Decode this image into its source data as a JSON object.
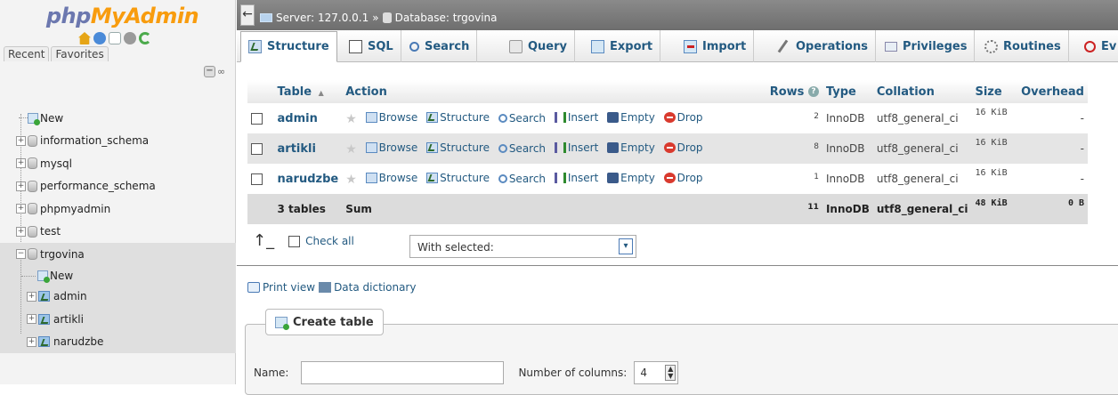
{
  "nav": {
    "logo_php": "php",
    "logo_myadmin": "MyAdmin",
    "tabs": [
      "Recent",
      "Favorites"
    ],
    "icons": [
      "home-icon",
      "logout-icon",
      "docs-icon",
      "settings-icon",
      "reload-icon"
    ],
    "tree": {
      "new": "New",
      "databases": [
        "information_schema",
        "mysql",
        "performance_schema",
        "phpmyadmin",
        "test",
        "trgovina"
      ],
      "trgovina_children": [
        "New",
        "admin",
        "artikli",
        "narudzbe"
      ]
    }
  },
  "breadcrumb": {
    "server": "Server: 127.0.0.1",
    "separator": "»",
    "database": "Database: trgovina"
  },
  "tabs": [
    "Structure",
    "SQL",
    "Search",
    "Query",
    "Export",
    "Import",
    "Operations",
    "Privileges",
    "Routines",
    "Ev"
  ],
  "table": {
    "headers": {
      "table": "Table",
      "sort_icon": "▲",
      "action": "Action",
      "rows": "Rows",
      "type": "Type",
      "collation": "Collation",
      "size": "Size",
      "overhead": "Overhead"
    },
    "actions": [
      "Browse",
      "Structure",
      "Search",
      "Insert",
      "Empty",
      "Drop"
    ],
    "rows": [
      {
        "name": "admin",
        "rows": "2",
        "type": "InnoDB",
        "collation": "utf8_general_ci",
        "size": "16 KiB",
        "overhead": "-"
      },
      {
        "name": "artikli",
        "rows": "8",
        "type": "InnoDB",
        "collation": "utf8_general_ci",
        "size": "16 KiB",
        "overhead": "-"
      },
      {
        "name": "narudzbe",
        "rows": "1",
        "type": "InnoDB",
        "collation": "utf8_general_ci",
        "size": "16 KiB",
        "overhead": "-"
      }
    ],
    "summary": {
      "label": "3 tables",
      "action": "Sum",
      "rows": "11",
      "type": "InnoDB",
      "collation": "utf8_general_ci",
      "size": "48 KiB",
      "overhead": "0 B"
    }
  },
  "bulk": {
    "check_all": "Check all",
    "with_selected": "With selected:"
  },
  "links": {
    "print_view": "Print view",
    "data_dictionary": "Data dictionary"
  },
  "create": {
    "legend": "Create table",
    "name_label": "Name:",
    "name_value": "",
    "columns_label": "Number of columns:",
    "columns_value": "4"
  },
  "colors": {
    "link_blue": "#235a81",
    "logo_php": "#6c78af",
    "logo_myadmin": "#f89c0e",
    "breadcrumb_bg": "#7a7a7a"
  }
}
